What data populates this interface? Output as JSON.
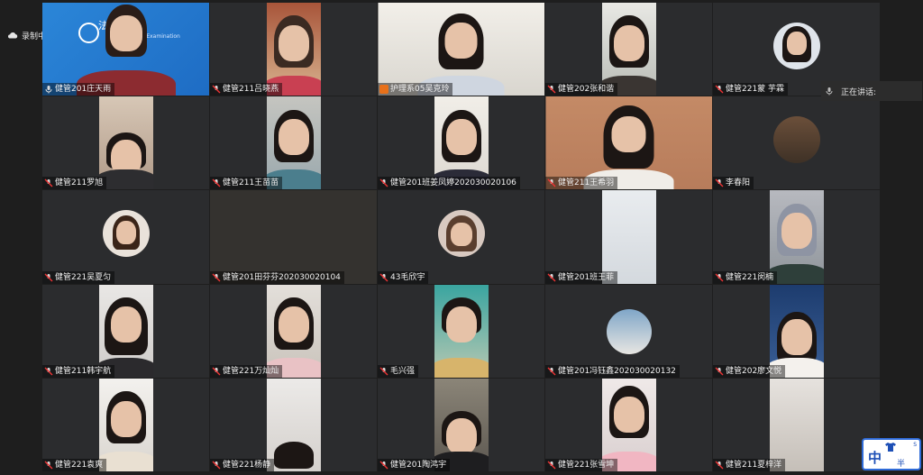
{
  "recording": {
    "label": "录制中"
  },
  "speaking": {
    "label": "正在讲话:"
  },
  "ime": {
    "zh": "中",
    "half": "半"
  },
  "tile1_logo": {
    "text": "法考",
    "sub": "alExamination"
  },
  "participants": [
    {
      "name": "健管201庄天雨"
    },
    {
      "name": "健管211吕晓燕"
    },
    {
      "name": "护理系05吴克玲"
    },
    {
      "name": "健管202张和谐"
    },
    {
      "name": "健管221蒙 芋霖"
    },
    {
      "name": "健管211罗旭"
    },
    {
      "name": "健管211王苗苗"
    },
    {
      "name": "健管201班姜凤婷202030020106"
    },
    {
      "name": "健管211王希羽"
    },
    {
      "name": "李春阳"
    },
    {
      "name": "健管221吴夏匀"
    },
    {
      "name": "健管201田芬芬202030020104"
    },
    {
      "name": "43毛欣宇"
    },
    {
      "name": "健管201班王菲"
    },
    {
      "name": "健管221闵楠"
    },
    {
      "name": "健管211韩宇航"
    },
    {
      "name": "健管221万灿灿"
    },
    {
      "name": "毛兴强"
    },
    {
      "name": "健管201冯钰鑫202030020132"
    },
    {
      "name": "健管202廖文悦"
    },
    {
      "name": "健管221袁爽"
    },
    {
      "name": "健管221杨静"
    },
    {
      "name": "健管201陶鸿宇"
    },
    {
      "name": "健管221张雪坤"
    },
    {
      "name": "健管211夏梓洋"
    }
  ]
}
